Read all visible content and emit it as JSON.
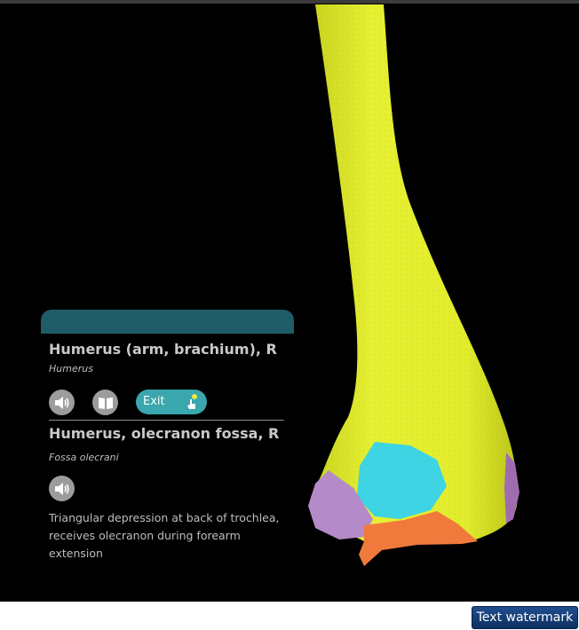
{
  "structure1": {
    "name": "Humerus (arm, brachium), R",
    "latin": "Humerus"
  },
  "structure2": {
    "name": "Humerus, olecranon fossa, R",
    "latin": "Fossa olecrani",
    "description": "Triangular depression at back of trochlea, receives olecranon during forearm extension"
  },
  "buttons": {
    "exit_label": "Exit",
    "watermark_label": "Text watermark"
  },
  "icons": {
    "audio": "speaker-icon",
    "book": "book-icon",
    "exit": "hand-pointer-icon"
  },
  "colors": {
    "bone": "#e5ef2e",
    "olecranon_fossa": "#3fd4e4",
    "medial_epicondyle": "#b58ac8",
    "trochlea": "#f07a3c",
    "lateral_region": "#a06cb0",
    "panel_header": "#1e5d68",
    "exit_button": "#3aa6ad"
  }
}
